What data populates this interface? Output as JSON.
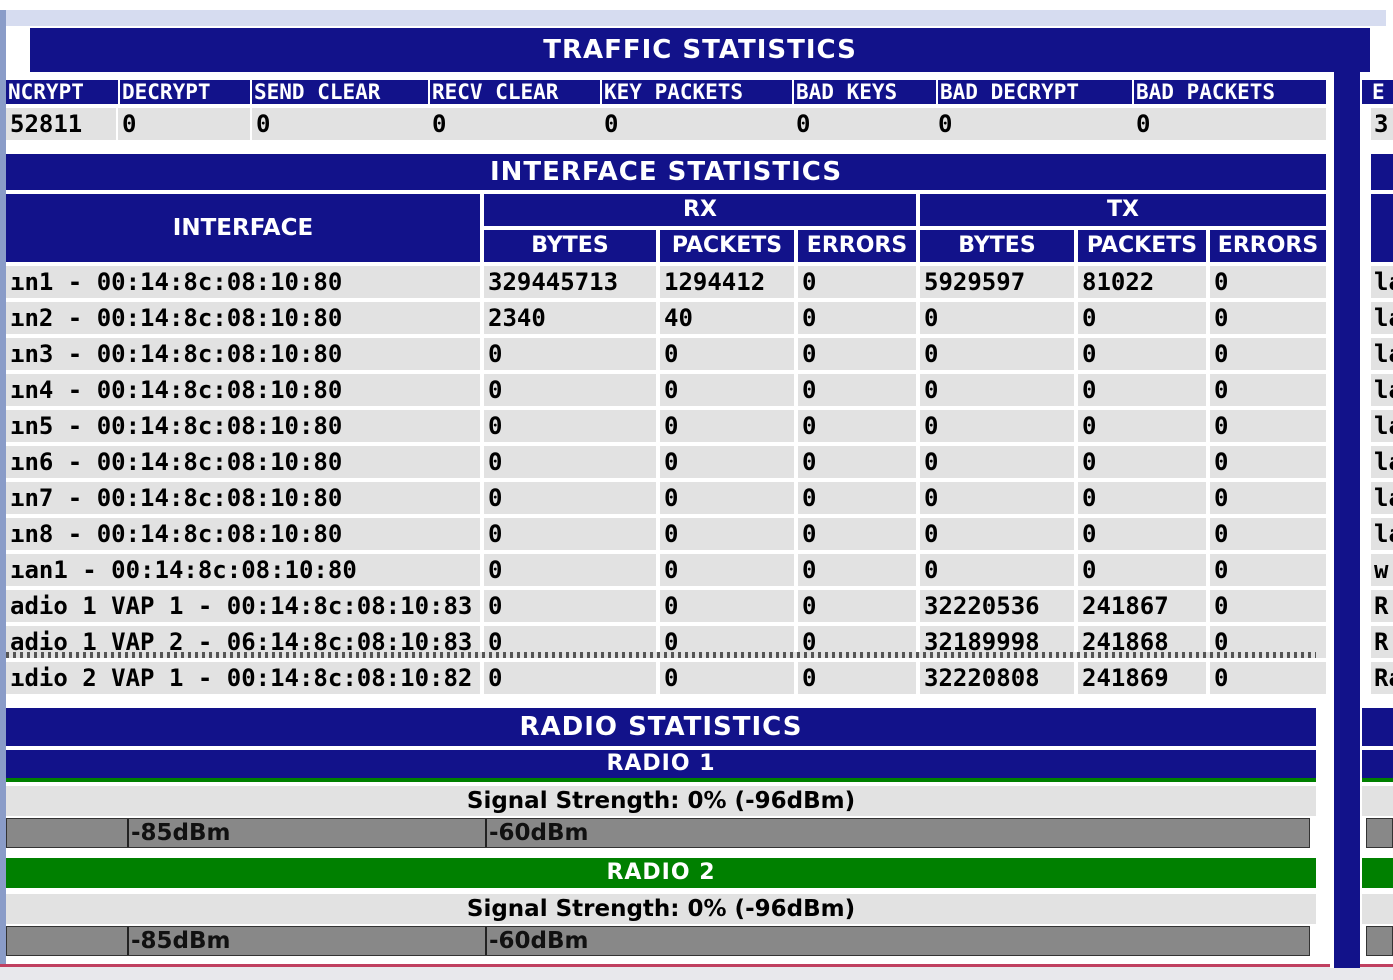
{
  "traffic": {
    "title": "TRAFFIC STATISTICS",
    "headers": [
      "NCRYPT",
      "DECRYPT",
      "SEND CLEAR",
      "RECV CLEAR",
      "KEY PACKETS",
      "BAD KEYS",
      "BAD DECRYPT",
      "BAD PACKETS"
    ],
    "values": [
      "52811",
      "0",
      "0",
      "0",
      "0",
      "0",
      "0",
      "0"
    ]
  },
  "interfaces": {
    "title": "INTERFACE STATISTICS",
    "interface_header": "INTERFACE",
    "rx_header": "RX",
    "tx_header": "TX",
    "sub_headers": [
      "BYTES",
      "PACKETS",
      "ERRORS",
      "BYTES",
      "PACKETS",
      "ERRORS"
    ],
    "rows": [
      {
        "name": "ın1 - 00:14:8c:08:10:80",
        "rx_bytes": "329445713",
        "rx_packets": "1294412",
        "rx_errors": "0",
        "tx_bytes": "5929597",
        "tx_packets": "81022",
        "tx_errors": "0"
      },
      {
        "name": "ın2 - 00:14:8c:08:10:80",
        "rx_bytes": "2340",
        "rx_packets": "40",
        "rx_errors": "0",
        "tx_bytes": "0",
        "tx_packets": "0",
        "tx_errors": "0"
      },
      {
        "name": "ın3 - 00:14:8c:08:10:80",
        "rx_bytes": "0",
        "rx_packets": "0",
        "rx_errors": "0",
        "tx_bytes": "0",
        "tx_packets": "0",
        "tx_errors": "0"
      },
      {
        "name": "ın4 - 00:14:8c:08:10:80",
        "rx_bytes": "0",
        "rx_packets": "0",
        "rx_errors": "0",
        "tx_bytes": "0",
        "tx_packets": "0",
        "tx_errors": "0"
      },
      {
        "name": "ın5 - 00:14:8c:08:10:80",
        "rx_bytes": "0",
        "rx_packets": "0",
        "rx_errors": "0",
        "tx_bytes": "0",
        "tx_packets": "0",
        "tx_errors": "0"
      },
      {
        "name": "ın6 - 00:14:8c:08:10:80",
        "rx_bytes": "0",
        "rx_packets": "0",
        "rx_errors": "0",
        "tx_bytes": "0",
        "tx_packets": "0",
        "tx_errors": "0"
      },
      {
        "name": "ın7 - 00:14:8c:08:10:80",
        "rx_bytes": "0",
        "rx_packets": "0",
        "rx_errors": "0",
        "tx_bytes": "0",
        "tx_packets": "0",
        "tx_errors": "0"
      },
      {
        "name": "ın8 - 00:14:8c:08:10:80",
        "rx_bytes": "0",
        "rx_packets": "0",
        "rx_errors": "0",
        "tx_bytes": "0",
        "tx_packets": "0",
        "tx_errors": "0"
      },
      {
        "name": "ıan1 - 00:14:8c:08:10:80",
        "rx_bytes": "0",
        "rx_packets": "0",
        "rx_errors": "0",
        "tx_bytes": "0",
        "tx_packets": "0",
        "tx_errors": "0"
      },
      {
        "name": "adio 1 VAP 1 - 00:14:8c:08:10:83",
        "rx_bytes": "0",
        "rx_packets": "0",
        "rx_errors": "0",
        "tx_bytes": "32220536",
        "tx_packets": "241867",
        "tx_errors": "0"
      },
      {
        "name": "adio 1 VAP 2 - 06:14:8c:08:10:83",
        "rx_bytes": "0",
        "rx_packets": "0",
        "rx_errors": "0",
        "tx_bytes": "32189998",
        "tx_packets": "241868",
        "tx_errors": "0"
      },
      {
        "name": "ıdio 2 VAP 1 - 00:14:8c:08:10:82",
        "rx_bytes": "0",
        "rx_packets": "0",
        "rx_errors": "0",
        "tx_bytes": "32220808",
        "tx_packets": "241869",
        "tx_errors": "0"
      }
    ]
  },
  "radio": {
    "title": "RADIO STATISTICS",
    "radios": [
      {
        "label": "RADIO 1",
        "signal": "Signal Strength: 0% (-96dBm)",
        "tick1": "-85dBm",
        "tick2": "-60dBm",
        "signal_fraction": 0.0
      },
      {
        "label": "RADIO 2",
        "signal": "Signal Strength: 0% (-96dBm)",
        "tick1": "-85dBm",
        "tick2": "-60dBm",
        "signal_fraction": 0.0
      }
    ]
  },
  "right_panel": {
    "traffic_value": "3",
    "traffic_header": "E",
    "row_labels": [
      "la",
      "la",
      "la",
      "la",
      "la",
      "la",
      "la",
      "la",
      "w",
      "R",
      "R",
      "Ra"
    ]
  },
  "colors": {
    "header_blue": "#12128a",
    "radio2_green": "#008000",
    "cell_gray": "#e2e2e2",
    "meter_gray": "#888888"
  }
}
